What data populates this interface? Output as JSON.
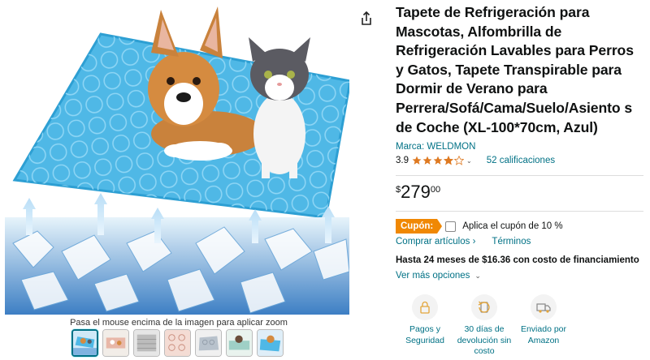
{
  "product": {
    "title": "Tapete de Refrigeración para Mascotas, Alfombrilla de Refrigeración Lavables para Perros y Gatos, Tapete Transpirable para Dormir de Verano para Perrera/Sofá/Cama/Suelo/Asiento s de Coche (XL-100*70cm, Azul)",
    "brand": "Marca: WELDMON",
    "rating_value": "3.9",
    "rating_stars": 3.9,
    "rating_count": "52 calificaciones"
  },
  "price": {
    "symbol": "$",
    "whole": "279",
    "fraction": "00"
  },
  "coupon": {
    "badge": "Cupón:",
    "text": "Aplica el cupón de 10 %",
    "checked": false
  },
  "links": {
    "compare": "Comprar artículos ›",
    "terms": "Términos"
  },
  "financing": {
    "text": "Hasta 24 meses de $16.36 con costo de financiamiento",
    "more": "Ver más opciones"
  },
  "features": [
    {
      "icon": "lock-icon",
      "label": "Pagos y Seguridad"
    },
    {
      "icon": "return-icon",
      "label": "30 días de devolución sin costo"
    },
    {
      "icon": "truck-icon",
      "label": "Enviado por Amazon"
    }
  ],
  "gallery": {
    "zoom_hint": "Pasa el mouse encima de la imagen para aplicar zoom",
    "thumb_count": 7,
    "selected_index": 0
  },
  "colors": {
    "link": "#007185",
    "coupon": "#f08804",
    "star": "#de7921",
    "mat": "#4fb8e6"
  }
}
